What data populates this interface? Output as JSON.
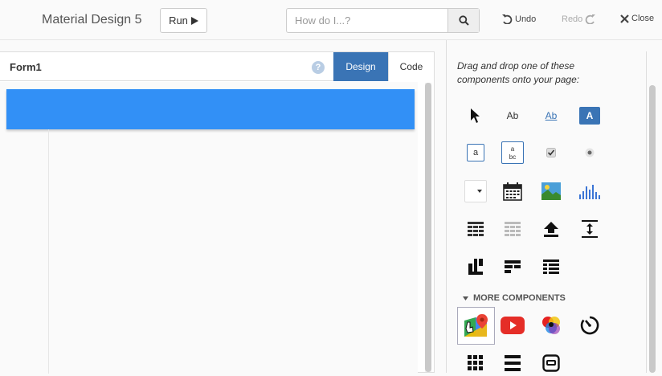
{
  "header": {
    "app_title": "Material Design 5",
    "run_label": "Run",
    "search_placeholder": "How do I...?",
    "undo_label": "Undo",
    "redo_label": "Redo",
    "close_label": "Close"
  },
  "form": {
    "title": "Form1",
    "help_glyph": "?",
    "tabs": [
      {
        "label": "Design",
        "active": true
      },
      {
        "label": "Code",
        "active": false
      }
    ],
    "nav_bar_color": "#3290f6"
  },
  "palette": {
    "intro": "Drag and drop one of these components onto your page:",
    "more_heading": "MORE COMPONENTS",
    "label_text": "Ab",
    "link_text": "Ab",
    "button_text": "A",
    "textbox_text": "a",
    "textarea_text": "a\nbc",
    "accent_color": "#3a74b5"
  }
}
